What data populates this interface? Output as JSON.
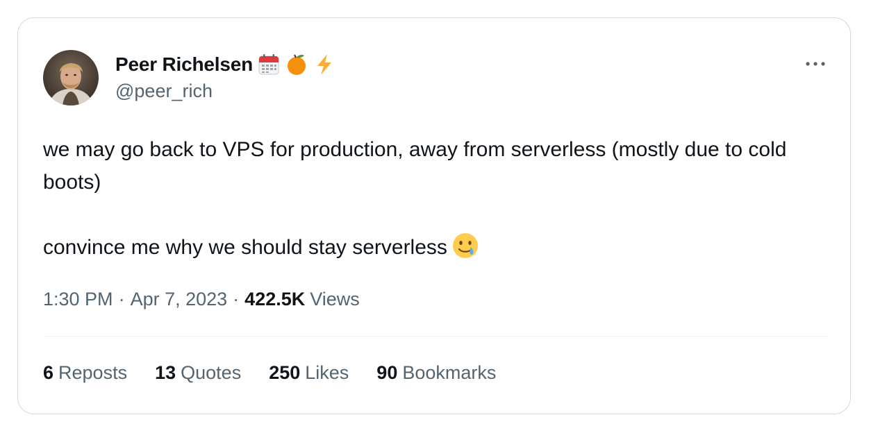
{
  "author": {
    "display_name": "Peer Richelsen",
    "handle": "@peer_rich",
    "badges": [
      "calendar-icon",
      "orange-icon",
      "lightning-icon"
    ]
  },
  "tweet": {
    "text": "we may go back to VPS for production, away from serverless (mostly due to cold boots)\n\nconvince me why we should stay serverless",
    "trailing_emoji": "crying-smile-icon"
  },
  "meta": {
    "time": "1:30 PM",
    "separator": "·",
    "date": "Apr 7, 2023",
    "views_count": "422.5K",
    "views_label": "Views"
  },
  "stats": [
    {
      "count": "6",
      "label": "Reposts"
    },
    {
      "count": "13",
      "label": "Quotes"
    },
    {
      "count": "250",
      "label": "Likes"
    },
    {
      "count": "90",
      "label": "Bookmarks"
    }
  ],
  "colors": {
    "text_primary": "#0f1419",
    "text_secondary": "#536471",
    "border": "#cfd9de"
  }
}
